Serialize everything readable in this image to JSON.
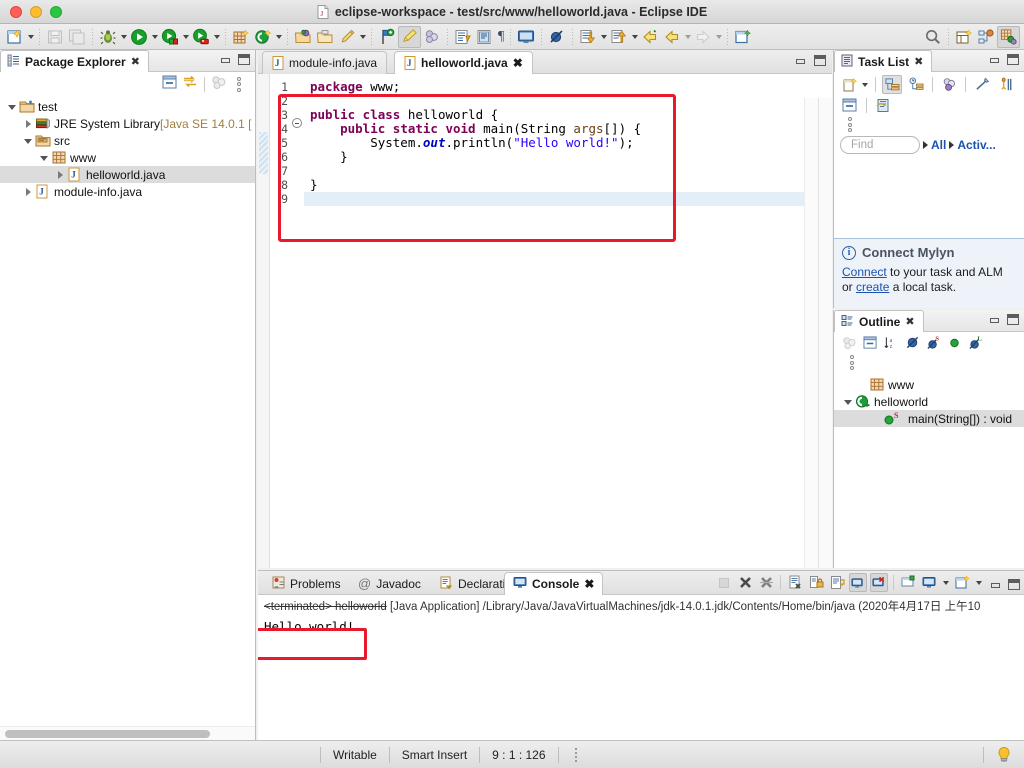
{
  "window": {
    "title": "eclipse-workspace - test/src/www/helloworld.java - Eclipse IDE",
    "traffic_lights": [
      "close",
      "minimize",
      "zoom"
    ]
  },
  "colors": {
    "accent_red_annotation": "#e8192c",
    "link_blue": "#1b52b0",
    "keyword_purple": "#7f0055",
    "string_blue": "#2a00ff",
    "field_blue": "#0000c0",
    "param_brown": "#6a3e1a",
    "selection_gray": "#dcdcdc",
    "mylyn_bg": "#eef3fa",
    "current_line": "#e4eef8"
  },
  "toolbar": {
    "items": [
      {
        "name": "new-wizard-icon",
        "has_dropdown": true
      },
      {
        "name": "save-icon",
        "has_dropdown": false
      },
      {
        "name": "save-all-icon",
        "has_dropdown": false
      },
      {
        "name": "debug-icon",
        "has_dropdown": true
      },
      {
        "name": "run-icon",
        "has_dropdown": true
      },
      {
        "name": "run-external-tools-icon",
        "has_dropdown": true
      },
      {
        "name": "coverage-icon",
        "has_dropdown": true
      },
      {
        "name": "new-java-package-icon",
        "has_dropdown": false
      },
      {
        "name": "new-java-class-icon",
        "has_dropdown": true
      },
      {
        "name": "open-type-icon",
        "has_dropdown": false
      },
      {
        "name": "open-task-icon",
        "has_dropdown": false
      },
      {
        "name": "quick-access-pen-icon",
        "has_dropdown": true
      },
      {
        "name": "search-marker-icon",
        "has_dropdown": false
      },
      {
        "name": "toggle-mark-occurrences-icon",
        "has_dropdown": false,
        "pressed": true
      },
      {
        "name": "link-with-editor-icon",
        "has_dropdown": false
      },
      {
        "name": "next-annotation-icon",
        "has_dropdown": false
      },
      {
        "name": "previous-annotation-icon",
        "has_dropdown": false
      },
      {
        "name": "show-whitespace-icon",
        "has_dropdown": false
      },
      {
        "name": "console-icon",
        "has_dropdown": false
      },
      {
        "name": "skip-breakpoints-icon",
        "has_dropdown": false
      },
      {
        "name": "next-edit-icon",
        "has_dropdown": true
      },
      {
        "name": "previous-edit-icon",
        "has_dropdown": true
      },
      {
        "name": "back-icon",
        "has_dropdown": false
      },
      {
        "name": "forward-icon",
        "has_dropdown": true
      },
      {
        "name": "forward-disabled-icon",
        "has_dropdown": true
      },
      {
        "name": "new-window-icon",
        "has_dropdown": false
      }
    ],
    "right_items": [
      {
        "name": "search-icon"
      },
      {
        "name": "open-perspective-icon"
      },
      {
        "name": "debug-perspective-icon"
      },
      {
        "name": "java-perspective-icon",
        "pressed": true
      }
    ]
  },
  "package_explorer": {
    "tab_label": "Package Explorer",
    "toolbar": [
      {
        "name": "collapse-all-icon"
      },
      {
        "name": "link-with-editor-icon"
      },
      {
        "name": "view-menu-filter-icon"
      },
      {
        "name": "view-menu-icon"
      }
    ],
    "tree": [
      {
        "label": "test",
        "icon": "java-project-icon",
        "indent": 0,
        "expanded": true,
        "selected": false
      },
      {
        "label": "JRE System Library",
        "suffix": " [Java SE 14.0.1 [",
        "icon": "jre-library-icon",
        "indent": 1,
        "expanded": false,
        "selected": false
      },
      {
        "label": "src",
        "icon": "source-folder-icon",
        "indent": 1,
        "expanded": true,
        "selected": false
      },
      {
        "label": "www",
        "icon": "package-icon",
        "indent": 2,
        "expanded": true,
        "selected": false
      },
      {
        "label": "helloworld.java",
        "icon": "java-file-icon",
        "indent": 3,
        "expanded": false,
        "selected": true
      },
      {
        "label": "module-info.java",
        "icon": "java-file-icon",
        "indent": 1,
        "expanded": false,
        "selected": false
      }
    ]
  },
  "editor": {
    "tabs": [
      {
        "label": "module-info.java",
        "icon": "java-file-icon",
        "active": false,
        "closable": false
      },
      {
        "label": "helloworld.java",
        "icon": "java-file-icon",
        "active": true,
        "closable": true
      }
    ],
    "line_numbers": [
      "1",
      "2",
      "3",
      "4",
      "5",
      "6",
      "7",
      "8",
      "9"
    ],
    "folding_line": "4",
    "current_line": "9",
    "code_lines": [
      {
        "n": "1",
        "tokens": [
          {
            "t": "package ",
            "c": "kw"
          },
          {
            "t": "www;",
            "c": ""
          }
        ]
      },
      {
        "n": "2",
        "tokens": []
      },
      {
        "n": "3",
        "tokens": [
          {
            "t": "public class ",
            "c": "kw"
          },
          {
            "t": "helloworld {",
            "c": ""
          }
        ]
      },
      {
        "n": "4",
        "tokens": [
          {
            "t": "    ",
            "c": ""
          },
          {
            "t": "public static void ",
            "c": "kw"
          },
          {
            "t": "main(String ",
            "c": ""
          },
          {
            "t": "args",
            "c": "par"
          },
          {
            "t": "[]) {",
            "c": ""
          }
        ]
      },
      {
        "n": "5",
        "tokens": [
          {
            "t": "        System.",
            "c": ""
          },
          {
            "t": "out",
            "c": "fld"
          },
          {
            "t": ".println(",
            "c": ""
          },
          {
            "t": "\"Hello world!\"",
            "c": "str"
          },
          {
            "t": ");",
            "c": ""
          }
        ]
      },
      {
        "n": "6",
        "tokens": [
          {
            "t": "    }",
            "c": ""
          }
        ]
      },
      {
        "n": "7",
        "tokens": []
      },
      {
        "n": "8",
        "tokens": [
          {
            "t": "}",
            "c": ""
          }
        ]
      },
      {
        "n": "9",
        "tokens": []
      }
    ]
  },
  "task_list": {
    "tab_label": "Task List",
    "toolbar_row1": [
      {
        "name": "new-task-icon",
        "has_dropdown": true
      },
      {
        "name": "categorized-presentation-icon",
        "pressed": true
      },
      {
        "name": "scheduled-presentation-icon"
      },
      {
        "name": "synchronize-changed-icon"
      },
      {
        "name": "focus-on-workweek-icon"
      },
      {
        "name": "show-task-hierarchy-icon"
      }
    ],
    "toolbar_row2": [
      {
        "name": "collapse-all-icon"
      },
      {
        "name": "restore-tasks-icon"
      }
    ],
    "menu_icon": "view-menu-icon",
    "find_placeholder": "Find",
    "filter_all_label": "All",
    "filter_activ_label": "Activ...",
    "mylyn": {
      "title": "Connect Mylyn",
      "line1_link": "Connect",
      "line1_text": " to your task and ALM",
      "line2_prefix": "or ",
      "line2_link": "create",
      "line2_suffix": " a local task."
    }
  },
  "outline": {
    "tab_label": "Outline",
    "toolbar": [
      {
        "name": "sort-members-icon"
      },
      {
        "name": "collapse-all-icon"
      },
      {
        "name": "sort-alphabetically-icon"
      },
      {
        "name": "hide-nonpublic-icon"
      },
      {
        "name": "hide-static-icon"
      },
      {
        "name": "hide-fields-icon"
      },
      {
        "name": "hide-local-types-icon"
      }
    ],
    "menu_icon": "view-menu-icon",
    "tree": [
      {
        "label": "www",
        "icon": "package-icon",
        "indent": 1,
        "expanded": null,
        "selected": false
      },
      {
        "label": "helloworld",
        "icon": "class-icon",
        "indent": 0,
        "expanded": true,
        "selected": false
      },
      {
        "label": "main(String[]) : void",
        "icon": "public-method-static-icon",
        "indent": 2,
        "expanded": null,
        "selected": true
      }
    ]
  },
  "console": {
    "tabs": [
      {
        "label": "Problems",
        "icon": "problems-icon",
        "active": false
      },
      {
        "label": "Javadoc",
        "icon": "javadoc-icon",
        "active": false
      },
      {
        "label": "Declaration",
        "icon": "declaration-icon",
        "active": false
      },
      {
        "label": "Console",
        "icon": "console-icon",
        "active": true,
        "closable": true
      }
    ],
    "toolbar": [
      {
        "name": "terminate-icon",
        "disabled": true
      },
      {
        "name": "remove-launch-icon"
      },
      {
        "name": "remove-all-terminated-icon"
      },
      {
        "name": "clear-console-icon"
      },
      {
        "name": "scroll-lock-icon"
      },
      {
        "name": "word-wrap-icon"
      },
      {
        "name": "pin-console-icon",
        "pressed": true
      },
      {
        "name": "display-selected-console-icon",
        "pressed": true
      },
      {
        "name": "open-console-icon"
      },
      {
        "name": "show-console-view-icon",
        "has_dropdown": true
      },
      {
        "name": "new-console-view-icon",
        "has_dropdown": true
      },
      {
        "name": "minimize-icon"
      },
      {
        "name": "maximize-icon"
      }
    ],
    "status_terminated": "<terminated> helloworld",
    "status_rest": " [Java Application] /Library/Java/JavaVirtualMachines/jdk-14.0.1.jdk/Contents/Home/bin/java  (2020年4月17日 上午10",
    "output": "Hello world!"
  },
  "statusbar": {
    "writable": "Writable",
    "insert_mode": "Smart Insert",
    "cursor_position": "9 : 1 : 126",
    "kebab_icon": "status-kebab-icon",
    "tip_icon": "lightbulb-icon"
  }
}
